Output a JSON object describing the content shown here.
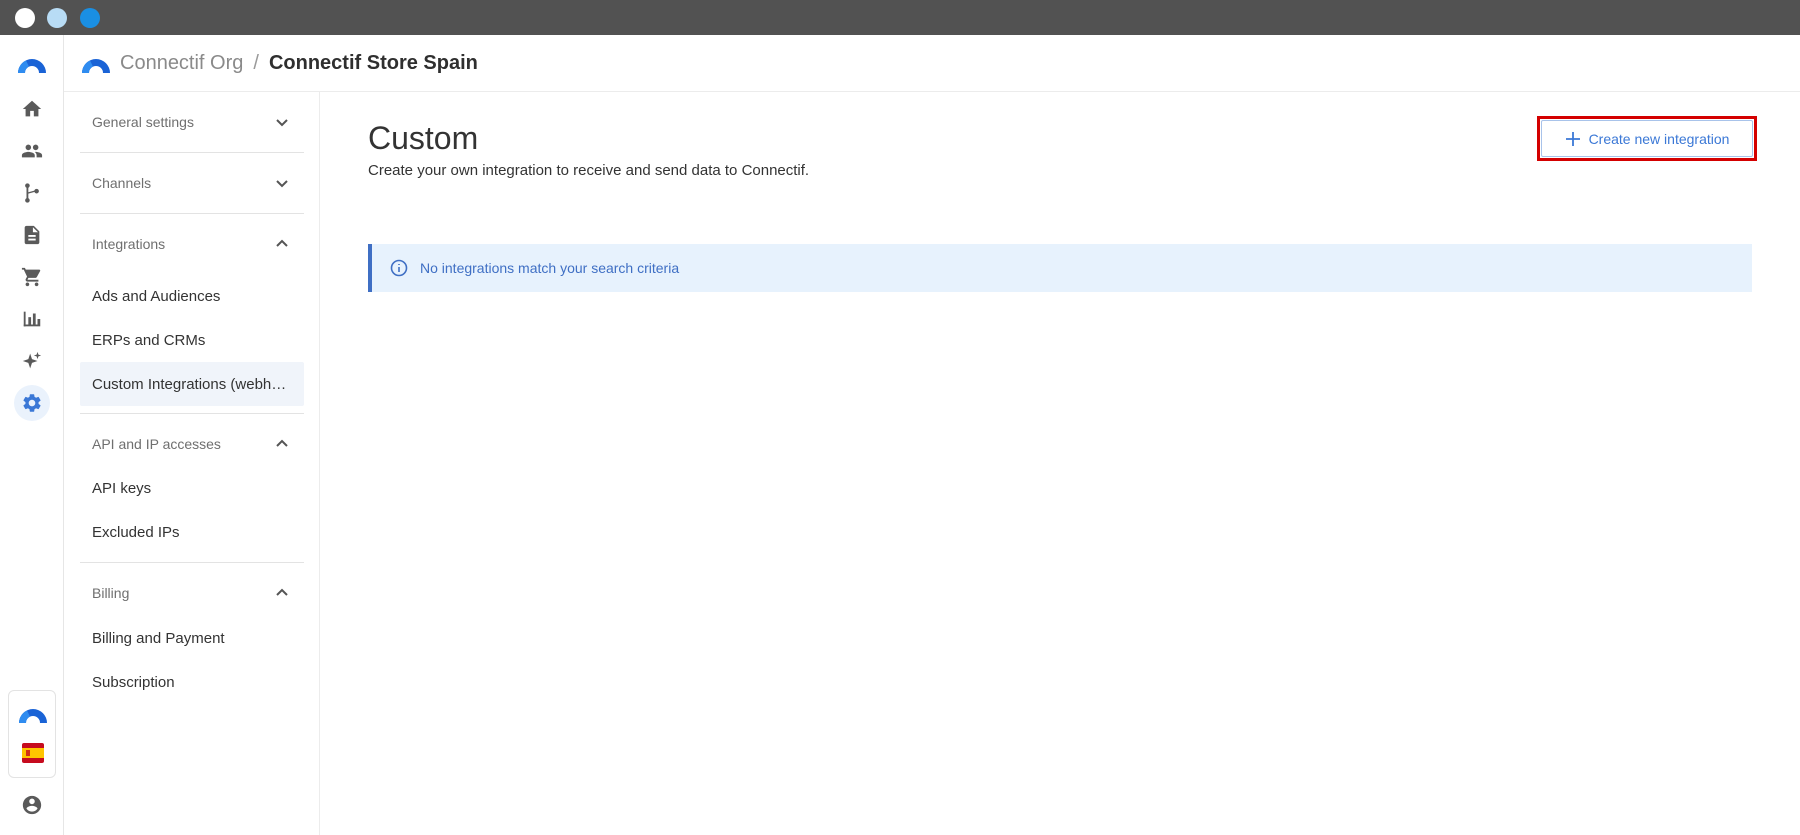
{
  "window": {
    "controls": [
      "close",
      "minimize",
      "maximize"
    ]
  },
  "header": {
    "org": "Connectif Org",
    "separator": "/",
    "store": "Connectif Store Spain"
  },
  "rail": {
    "items": [
      {
        "icon": "home-icon"
      },
      {
        "icon": "people-icon"
      },
      {
        "icon": "workflow-icon"
      },
      {
        "icon": "document-icon"
      },
      {
        "icon": "cart-icon"
      },
      {
        "icon": "bar-chart-icon"
      },
      {
        "icon": "sparkle-icon"
      },
      {
        "icon": "gear-icon",
        "active": true
      }
    ],
    "bottom": [
      "connectif-logo-icon",
      "spain-flag-icon",
      "account-icon"
    ]
  },
  "sidemenu": {
    "sections": [
      {
        "label": "General settings",
        "expanded": false
      },
      {
        "label": "Channels",
        "expanded": false
      },
      {
        "label": "Integrations",
        "expanded": true,
        "items": [
          "Ads and Audiences",
          "ERPs and CRMs",
          "Custom Integrations (webhooks)"
        ]
      },
      {
        "label": "API and IP accesses",
        "expanded": true,
        "items": [
          "API keys",
          "Excluded IPs"
        ]
      },
      {
        "label": "Billing",
        "expanded": true,
        "items": [
          "Billing and Payment",
          "Subscription"
        ]
      }
    ],
    "selected": "Custom Integrations (webhooks)"
  },
  "main": {
    "title": "Custom",
    "subtitle": "Create your own integration to receive and send data to Connectif.",
    "create_button": "Create new integration",
    "info_message": "No integrations match your search criteria"
  },
  "colors": {
    "accent": "#3b78d6",
    "highlight_outline": "#d40000",
    "info_bg": "#e7f2fd"
  }
}
